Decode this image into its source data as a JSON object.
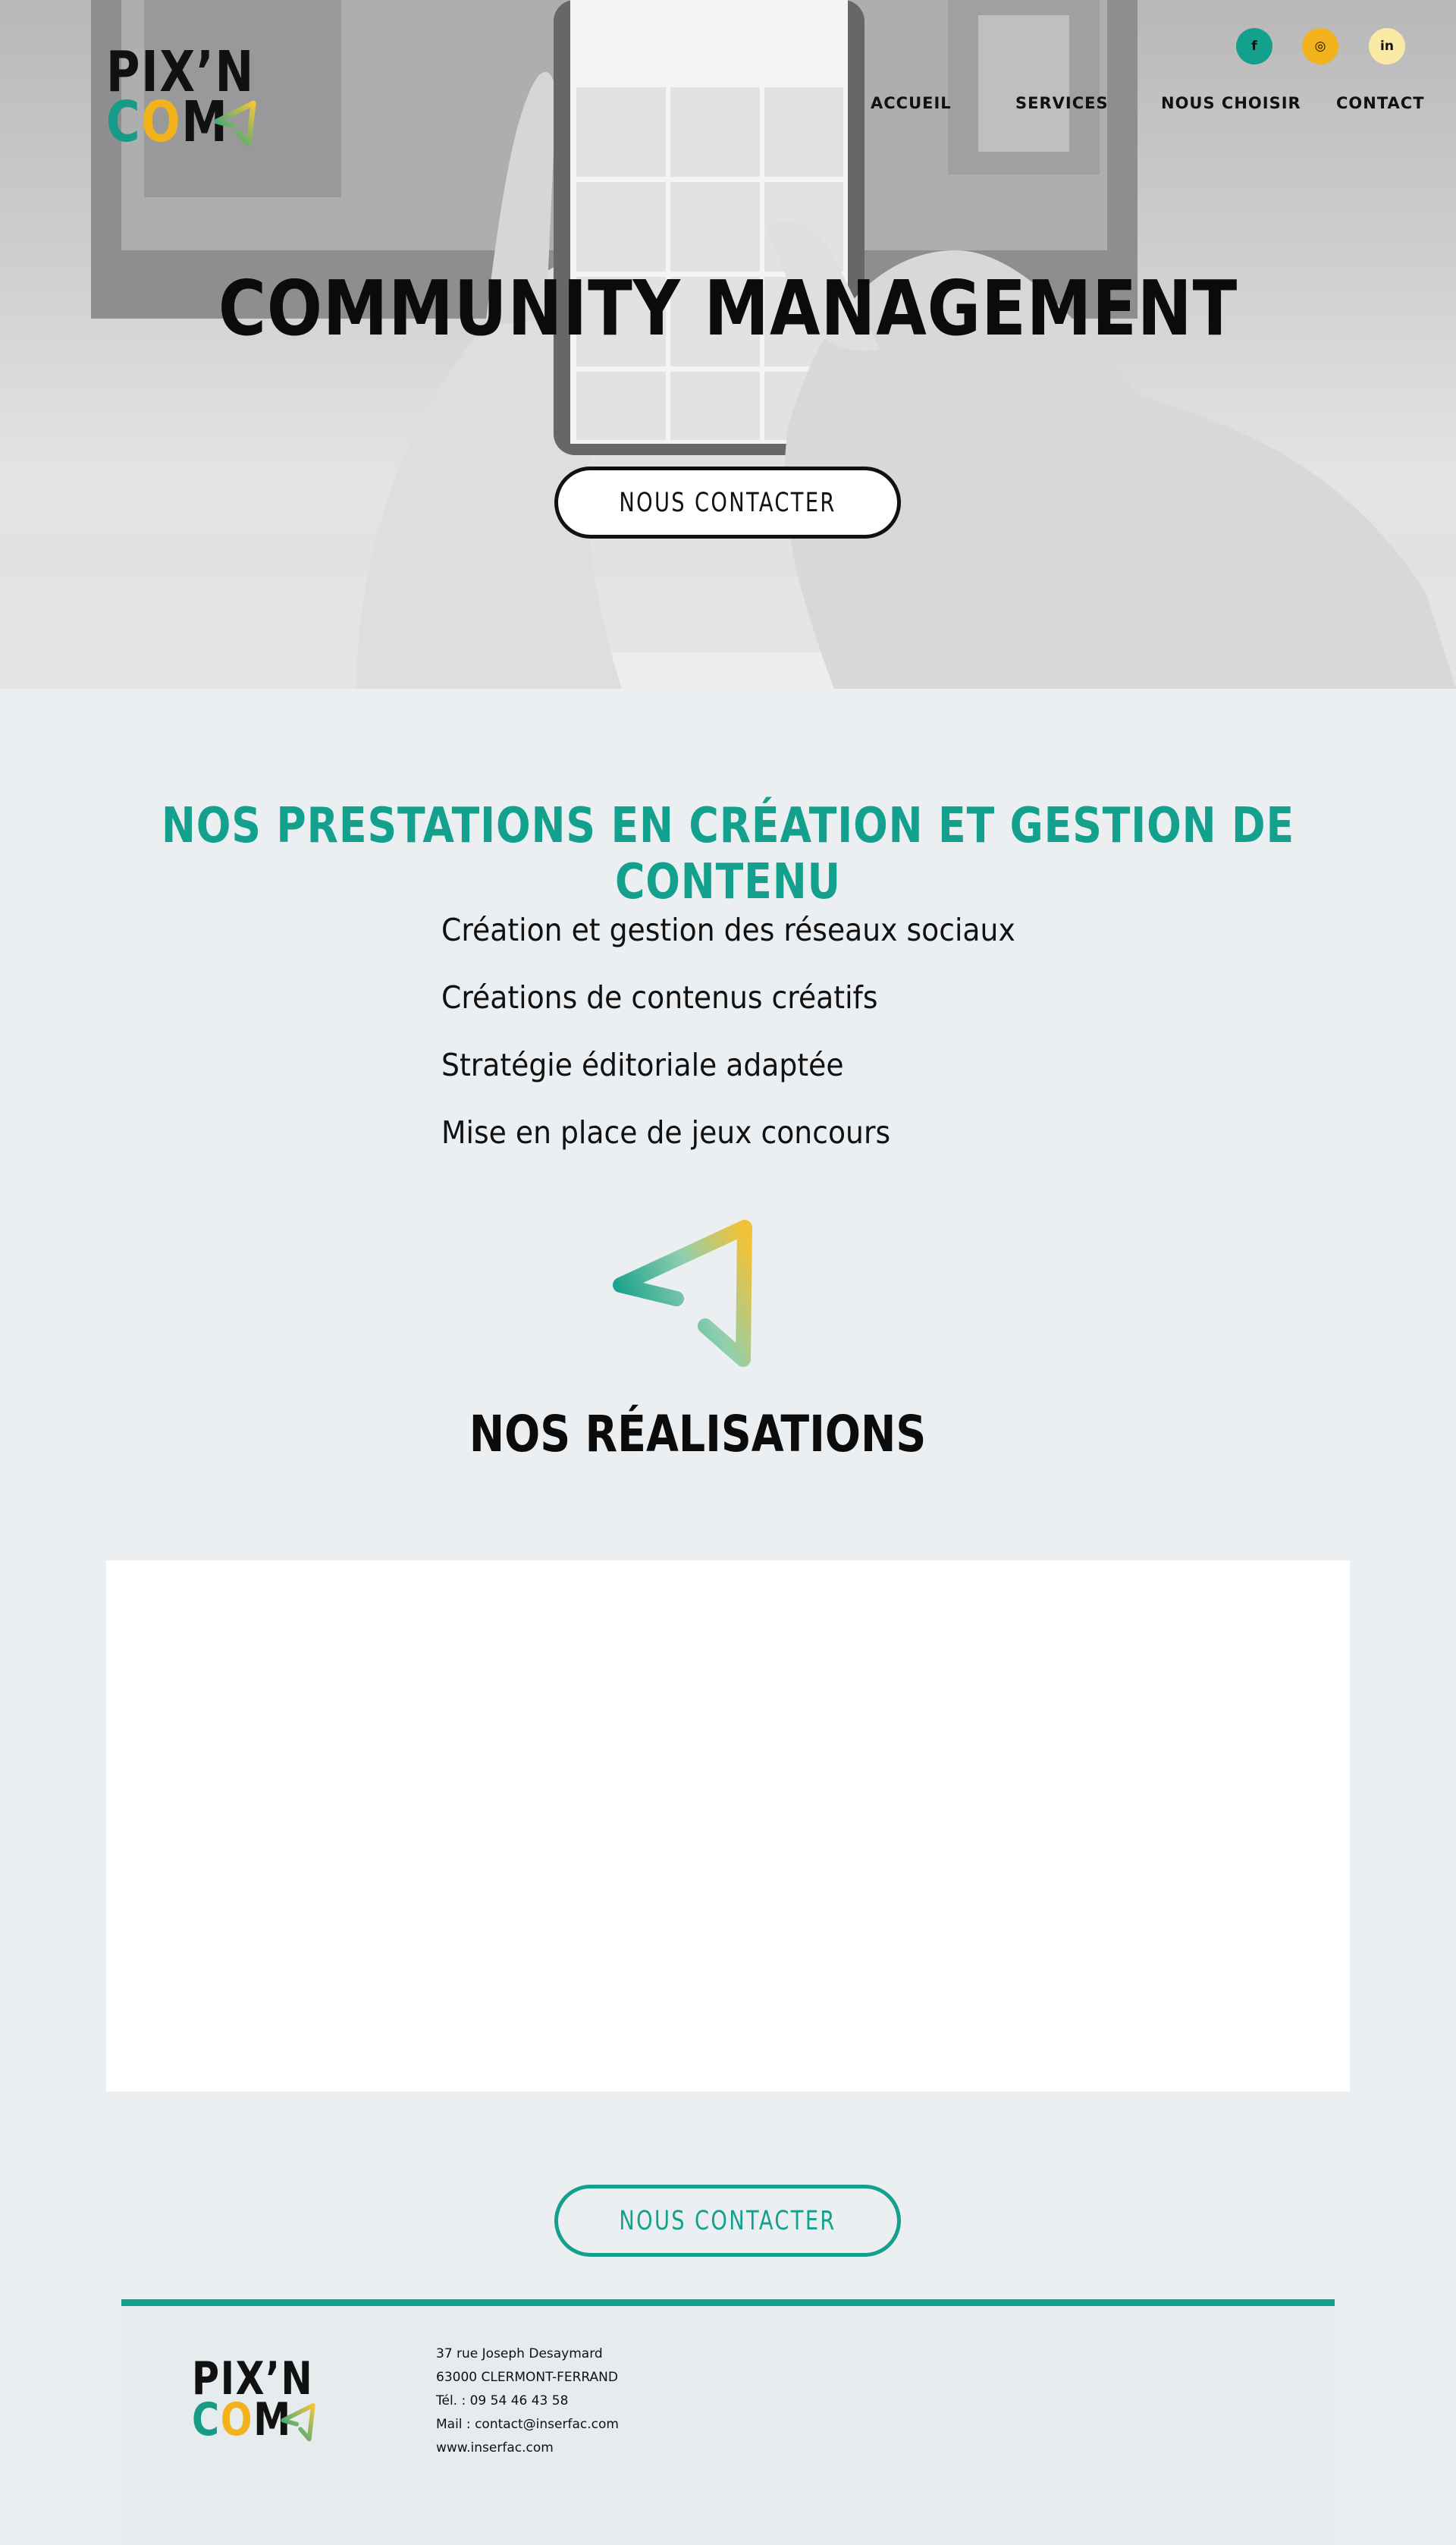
{
  "brand": {
    "logo_line1": "PIX’N",
    "logo_c": "C",
    "logo_o": "O",
    "logo_m": "M",
    "teal": "#13a08c",
    "yellow": "#f2b21c",
    "cream": "#fbe9a6"
  },
  "social": [
    {
      "name": "facebook",
      "glyph": "f",
      "color": "#13a08c"
    },
    {
      "name": "instagram",
      "glyph": "◎",
      "color": "#f2b21c"
    },
    {
      "name": "linkedin",
      "glyph": "in",
      "color": "#fbe9a6"
    }
  ],
  "nav": {
    "home": "ACCUEIL",
    "services": "SERVICES",
    "why_us": "NOUS CHOISIR",
    "contact": "CONTACT"
  },
  "hero": {
    "title": "COMMUNITY MANAGEMENT",
    "cta": "NOUS  CONTACTER"
  },
  "services": {
    "title": "NOS PRESTATIONS EN CRÉATION ET GESTION DE CONTENU",
    "items": [
      "Création et gestion des réseaux sociaux",
      "Créations de contenus créatifs",
      "Stratégie éditoriale adaptée",
      "Mise en place de jeux concours"
    ]
  },
  "realisations": {
    "title": "NOS RÉALISATIONS",
    "cta": "NOUS  CONTACTER"
  },
  "footer": {
    "address": "37 rue Joseph Desaymard",
    "city": "63000 CLERMONT-FERRAND",
    "phone": "Tél. : 09 54 46 43 58",
    "mail": "Mail : contact@inserfac.com",
    "web": "www.inserfac.com"
  }
}
